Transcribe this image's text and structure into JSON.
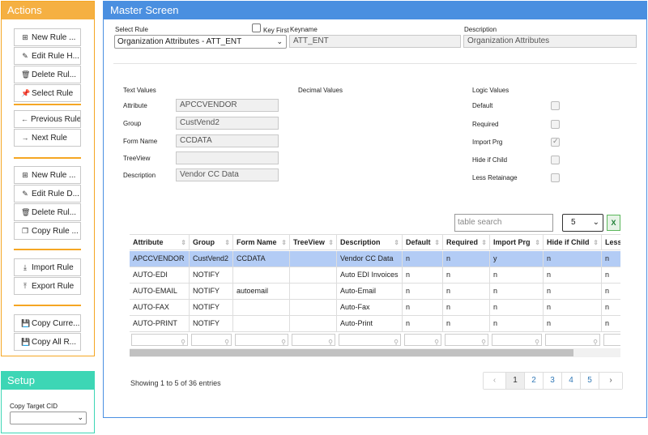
{
  "actions": {
    "title": "Actions",
    "group1": [
      {
        "icon": "plus-square-icon",
        "glyph": "⊞",
        "label": "New Rule ..."
      },
      {
        "icon": "pencil-icon",
        "glyph": "✎",
        "label": "Edit Rule H..."
      },
      {
        "icon": "trash-icon",
        "glyph": "🗑",
        "label": "Delete Rul..."
      },
      {
        "icon": "pin-icon",
        "glyph": "📌",
        "label": "Select Rule"
      }
    ],
    "group2": [
      {
        "icon": "arrow-left-icon",
        "glyph": "←",
        "label": "Previous Rule"
      },
      {
        "icon": "arrow-right-icon",
        "glyph": "→",
        "label": "Next Rule"
      }
    ],
    "group3": [
      {
        "icon": "plus-square-icon",
        "glyph": "⊞",
        "label": "New Rule ..."
      },
      {
        "icon": "pencil-icon",
        "glyph": "✎",
        "label": "Edit Rule D..."
      },
      {
        "icon": "trash-icon",
        "glyph": "🗑",
        "label": "Delete Rul..."
      },
      {
        "icon": "copy-icon",
        "glyph": "❐",
        "label": "Copy Rule ..."
      }
    ],
    "group4": [
      {
        "icon": "import-icon",
        "glyph": "⤓",
        "label": "Import Rule"
      },
      {
        "icon": "export-icon",
        "glyph": "⤒",
        "label": "Export Rule"
      }
    ],
    "group5": [
      {
        "icon": "floppy-icon",
        "glyph": "💾",
        "label": "Copy Curre..."
      },
      {
        "icon": "floppy-icon",
        "glyph": "💾",
        "label": "Copy All R..."
      }
    ]
  },
  "setup": {
    "title": "Setup",
    "copy_target_label": "Copy Target CID",
    "copy_target_value": ""
  },
  "master": {
    "title": "Master Screen",
    "select_rule_label": "Select Rule",
    "select_rule_value": "Organization Attributes - ATT_ENT",
    "key_first_label": "Key First",
    "keyname_label": "Keyname",
    "keyname_value": "ATT_ENT",
    "description_label": "Description",
    "description_value": "Organization Attributes",
    "text_values": {
      "heading": "Text Values",
      "fields": [
        {
          "label": "Attribute",
          "value": "APCCVENDOR"
        },
        {
          "label": "Group",
          "value": "CustVend2"
        },
        {
          "label": "Form Name",
          "value": "CCDATA"
        },
        {
          "label": "TreeView",
          "value": ""
        },
        {
          "label": "Description",
          "value": "Vendor CC Data"
        }
      ]
    },
    "decimal_values": {
      "heading": "Decimal Values"
    },
    "logic_values": {
      "heading": "Logic Values",
      "fields": [
        {
          "label": "Default",
          "checked": false
        },
        {
          "label": "Required",
          "checked": false
        },
        {
          "label": "Import Prg",
          "checked": true
        },
        {
          "label": "Hide if Child",
          "checked": false
        },
        {
          "label": "Less Retainage",
          "checked": false
        }
      ]
    }
  },
  "table": {
    "search_placeholder": "table search",
    "page_size": "5",
    "excel_label": "X",
    "columns": [
      "Attribute",
      "Group",
      "Form Name",
      "TreeView",
      "Description",
      "Default",
      "Required",
      "Import Prg",
      "Hide if Child",
      "Less"
    ],
    "rows": [
      [
        "APCCVENDOR",
        "CustVend2",
        "CCDATA",
        "",
        "Vendor CC Data",
        "n",
        "n",
        "y",
        "n",
        "n"
      ],
      [
        "AUTO-EDI",
        "NOTIFY",
        "",
        "",
        "Auto EDI Invoices",
        "n",
        "n",
        "n",
        "n",
        "n"
      ],
      [
        "AUTO-EMAIL",
        "NOTIFY",
        "autoemail",
        "",
        "Auto-Email",
        "n",
        "n",
        "n",
        "n",
        "n"
      ],
      [
        "AUTO-FAX",
        "NOTIFY",
        "",
        "",
        "Auto-Fax",
        "n",
        "n",
        "n",
        "n",
        "n"
      ],
      [
        "AUTO-PRINT",
        "NOTIFY",
        "",
        "",
        "Auto-Print",
        "n",
        "n",
        "n",
        "n",
        "n"
      ]
    ],
    "showing_text": "Showing 1 to 5 of 36 entries",
    "pagination": {
      "prev": "‹",
      "pages": [
        "1",
        "2",
        "3",
        "4",
        "5"
      ],
      "next": "›",
      "active": "1"
    }
  }
}
